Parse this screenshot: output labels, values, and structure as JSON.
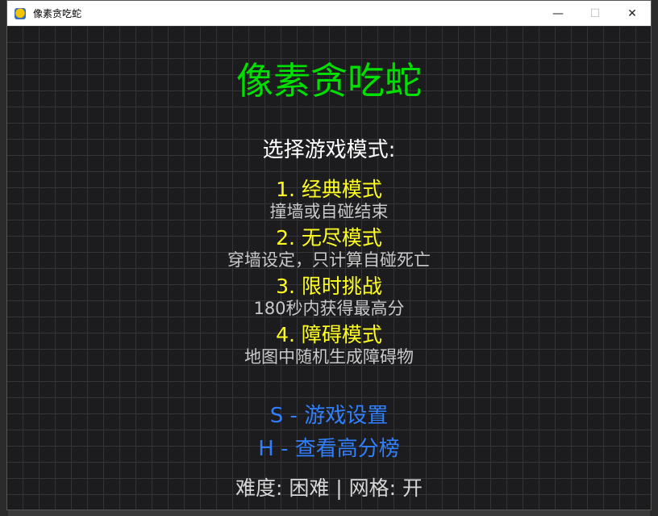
{
  "window": {
    "title": "像素贪吃蛇",
    "minimize_label": "—",
    "maximize_label": "☐",
    "close_label": "✕"
  },
  "game": {
    "title": "像素贪吃蛇",
    "prompt": "选择游戏模式:",
    "modes": [
      {
        "name": "1. 经典模式",
        "desc": "撞墙或自碰结束"
      },
      {
        "name": "2. 无尽模式",
        "desc": "穿墙设定，只计算自碰死亡"
      },
      {
        "name": "3. 限时挑战",
        "desc": "180秒内获得最高分"
      },
      {
        "name": "4. 障碍模式",
        "desc": "地图中随机生成障碍物"
      }
    ],
    "settings_link": "S - 游戏设置",
    "leaderboard_link": "H - 查看高分榜",
    "status": "难度: 困难 | 网格: 开"
  },
  "colors": {
    "title": "#00e000",
    "mode_name": "#ffff1e",
    "mode_desc": "#c9c9c9",
    "link": "#2f7fff",
    "background": "#1c1c1e",
    "grid": "#333338"
  }
}
